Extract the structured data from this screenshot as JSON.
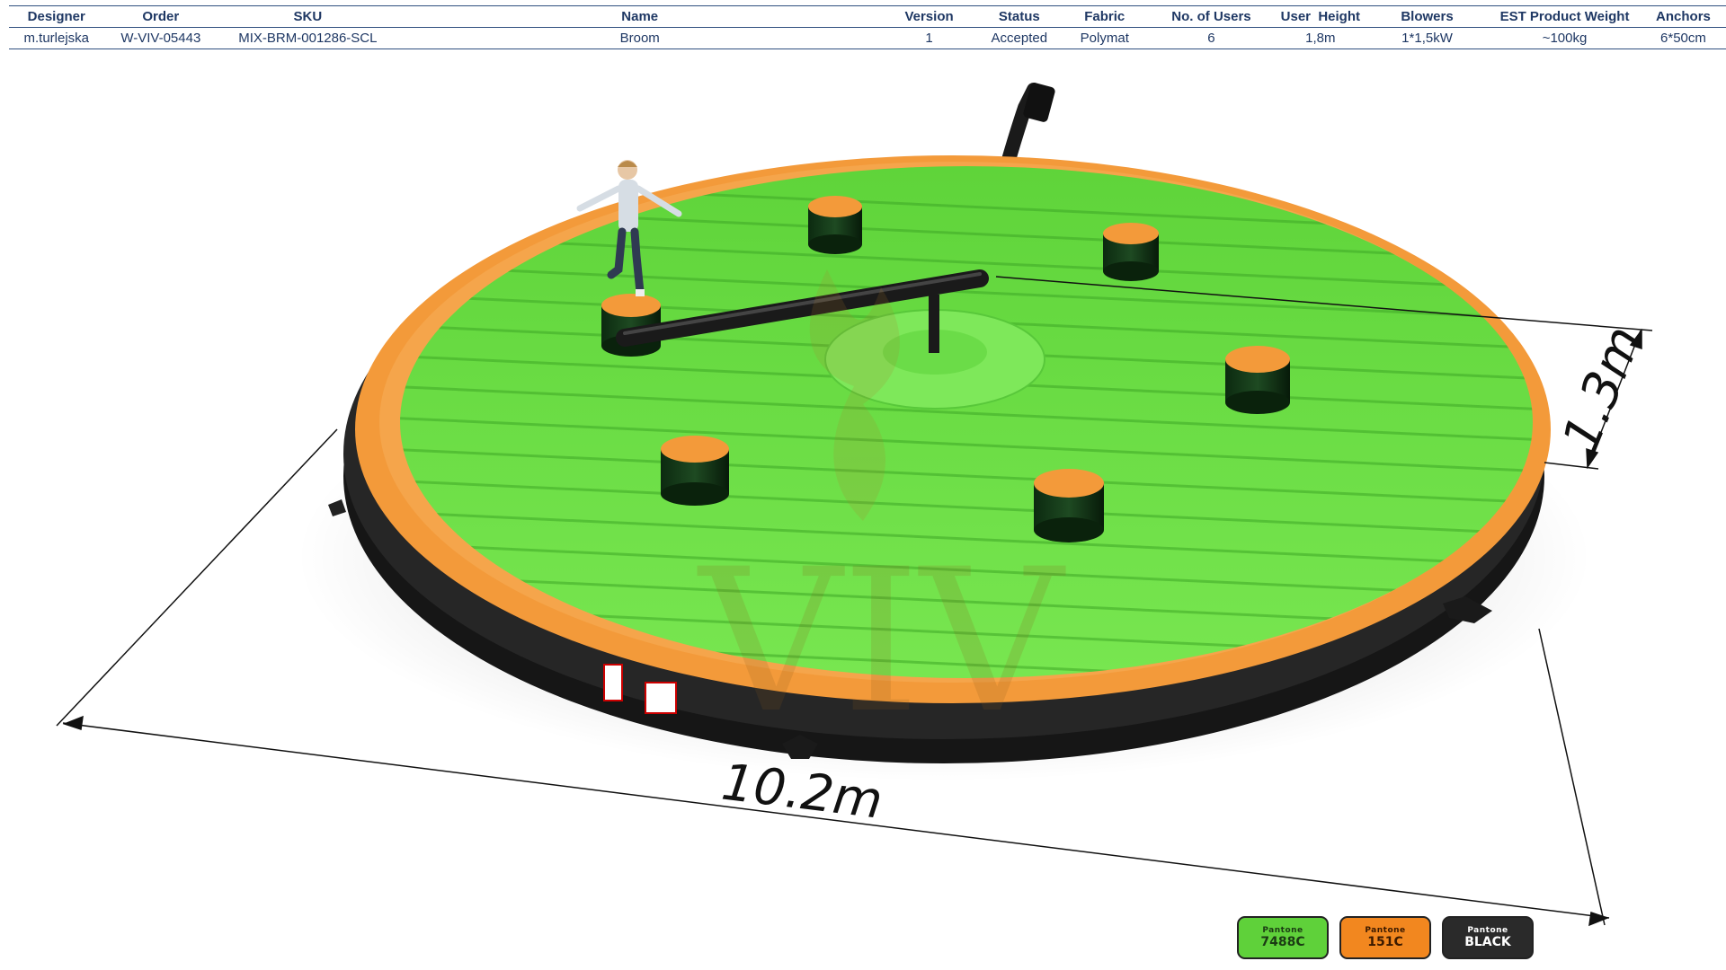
{
  "spec": {
    "headers": [
      "Designer",
      "Order",
      "SKU",
      "Name",
      "Version",
      "Status",
      "Fabric",
      "No. of Users",
      "User  Height",
      "Blowers",
      "EST Product Weight",
      "Anchors"
    ],
    "values": [
      "m.turlejska",
      "W-VIV-05443",
      "MIX-BRM-001286-SCL",
      "Broom",
      "1",
      "Accepted",
      "Polymat",
      "6",
      "1,8m",
      "1*1,5kW",
      "~100kg",
      "6*50cm"
    ]
  },
  "dimensions": {
    "diameter": "10.2m",
    "height": "1.3m"
  },
  "watermark": "VIV",
  "pantone": [
    {
      "label": "Pantone",
      "code": "7488C",
      "color": "#5fd13a"
    },
    {
      "label": "Pantone",
      "code": "151C",
      "color": "#f2871f"
    },
    {
      "label": "Pantone",
      "code": "BLACK",
      "color": "#2a2a2a"
    }
  ],
  "colors": {
    "mat_green": "#6fe04a",
    "ring_orange": "#f39a3a",
    "base_black": "#1b1b1b"
  }
}
